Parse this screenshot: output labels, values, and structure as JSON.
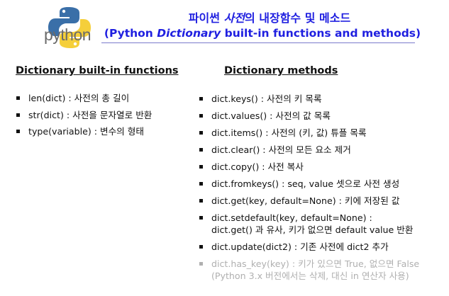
{
  "logo": {
    "text": "python"
  },
  "title": {
    "line1_prefix": "파이썬 ",
    "line1_italic": "사전",
    "line1_suffix": "의 내장함수 및 메소드",
    "line2_prefix": "(Python ",
    "line2_italic": "Dictionary",
    "line2_suffix": " built-in functions and methods)"
  },
  "colors": {
    "title": "#1f1fe0",
    "deprecated": "#b0b0b0"
  },
  "builtin": {
    "heading": "Dictionary built-in functions",
    "items": [
      "len(dict) : 사전의 총 길이",
      "str(dict) : 사전을 문자열로 반환",
      "type(variable) : 변수의 형태"
    ]
  },
  "methods": {
    "heading": "Dictionary methods",
    "items": [
      {
        "lines": [
          "dict.keys() : 사전의 키 목록"
        ]
      },
      {
        "lines": [
          "dict.values() : 사전의 값 목록"
        ]
      },
      {
        "lines": [
          "dict.items() : 사전의 (키, 값) 튜플 목록"
        ]
      },
      {
        "lines": [
          "dict.clear() : 사전의 모든 요소 제거"
        ]
      },
      {
        "lines": [
          "dict.copy() : 사전 복사"
        ]
      },
      {
        "lines": [
          "dict.fromkeys() : seq, value 셋으로 사전 생성"
        ]
      },
      {
        "lines": [
          "dict.get(key, default=None) : 키에 저장된 값"
        ]
      },
      {
        "lines": [
          "dict.setdefault(key, default=None) :",
          "dict.get() 과 유사, 키가 없으면 default value 반환"
        ]
      },
      {
        "lines": [
          "dict.update(dict2) : 기존 사전에 dict2 추가"
        ]
      },
      {
        "lines": [
          "dict.has_key(key) : 키가 있으면 True, 없으면 False",
          "(Python 3.x 버전에서는 삭제, 대신 in 연산자 사용)"
        ],
        "deprecated": true
      }
    ]
  }
}
